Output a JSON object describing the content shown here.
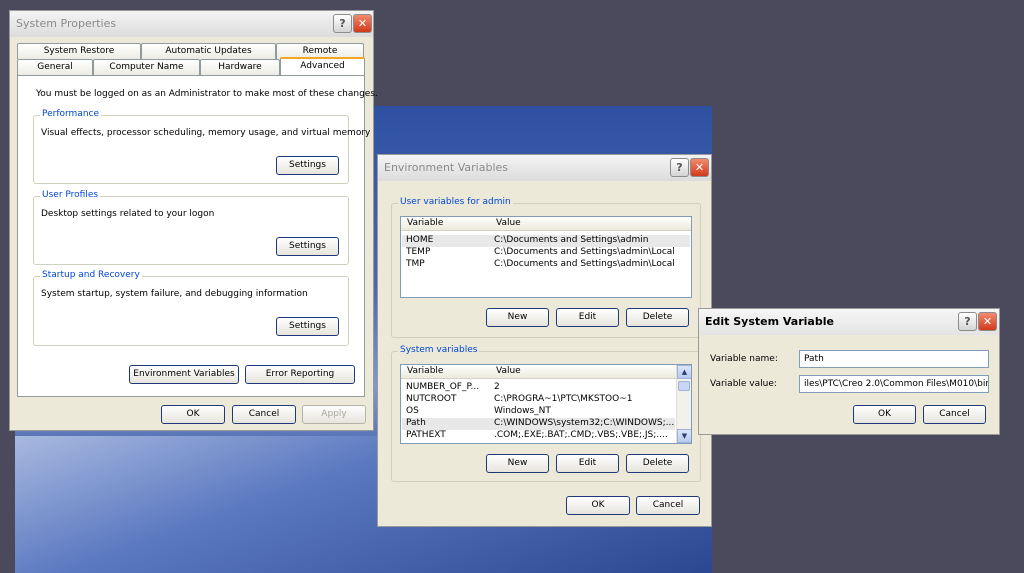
{
  "system_properties": {
    "title": "System Properties",
    "tabs_row1": [
      "System Restore",
      "Automatic Updates",
      "Remote"
    ],
    "tabs_row2": [
      "General",
      "Computer Name",
      "Hardware",
      "Advanced"
    ],
    "admin_note": "You must be logged on as an Administrator to make most of these changes.",
    "performance": {
      "legend": "Performance",
      "desc": "Visual effects, processor scheduling, memory usage, and virtual memory",
      "button": "Settings"
    },
    "user_profiles": {
      "legend": "User Profiles",
      "desc": "Desktop settings related to your logon",
      "button": "Settings"
    },
    "startup_recovery": {
      "legend": "Startup and Recovery",
      "desc": "System startup, system failure, and debugging information",
      "button": "Settings"
    },
    "env_button": "Environment Variables",
    "error_button": "Error Reporting",
    "ok": "OK",
    "cancel": "Cancel",
    "apply": "Apply"
  },
  "env_vars": {
    "title": "Environment Variables",
    "user_legend": "User variables for admin",
    "col_variable": "Variable",
    "col_value": "Value",
    "user_rows": [
      {
        "var": "HOME",
        "val": "C:\\Documents and Settings\\admin"
      },
      {
        "var": "TEMP",
        "val": "C:\\Documents and Settings\\admin\\Local..."
      },
      {
        "var": "TMP",
        "val": "C:\\Documents and Settings\\admin\\Local..."
      }
    ],
    "sys_legend": "System variables",
    "sys_rows": [
      {
        "var": "NUMBER_OF_P...",
        "val": "2"
      },
      {
        "var": "NUTCROOT",
        "val": "C:\\PROGRA~1\\PTC\\MKSTOO~1"
      },
      {
        "var": "OS",
        "val": "Windows_NT"
      },
      {
        "var": "Path",
        "val": "C:\\WINDOWS\\system32;C:\\WINDOWS;..."
      },
      {
        "var": "PATHEXT",
        "val": ".COM;.EXE;.BAT;.CMD;.VBS;.VBE;.JS;...."
      }
    ],
    "new": "New",
    "edit": "Edit",
    "delete": "Delete",
    "ok": "OK",
    "cancel": "Cancel"
  },
  "edit_var": {
    "title": "Edit System Variable",
    "name_label": "Variable name:",
    "name_value": "Path",
    "value_label": "Variable value:",
    "value_value": "iles\\PTC\\Creo 2.0\\Common Files\\M010\\bin",
    "ok": "OK",
    "cancel": "Cancel"
  },
  "icons": {
    "help": "?",
    "close": "✕",
    "scroll_up": "▲",
    "scroll_down": "▼"
  }
}
